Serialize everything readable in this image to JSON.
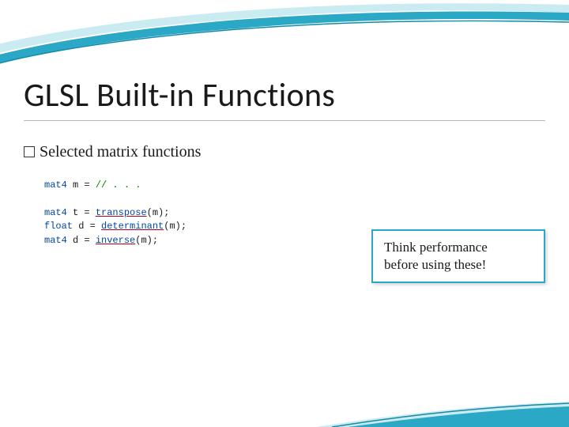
{
  "title": "GLSL Built-in Functions",
  "subtitle": "Selected matrix functions",
  "code": {
    "l1_kw": "mat4",
    "l1_rest": " m = ",
    "l1_cm": "// . . .",
    "l2_kw": "mat4",
    "l2_mid": " t = ",
    "l2_fn": "transpose",
    "l2_tail": "(m);",
    "l3_kw": "float",
    "l3_mid": " d = ",
    "l3_fn": "determinant",
    "l3_tail": "(m);",
    "l4_kw": "mat4",
    "l4_mid": " d = ",
    "l4_fn": "inverse",
    "l4_tail": "(m);"
  },
  "callout": {
    "line1": "Think performance",
    "line2": "before using these!"
  }
}
